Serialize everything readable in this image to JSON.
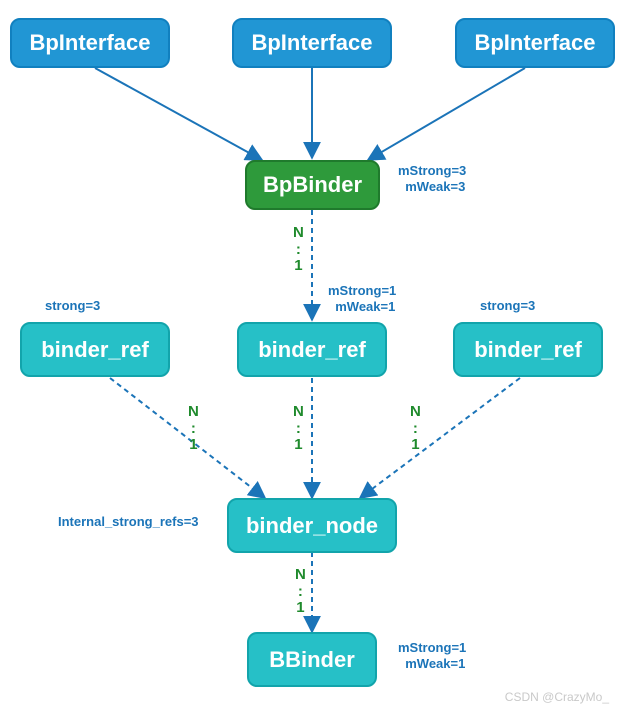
{
  "nodes": {
    "bp1": "BpInterface",
    "bp2": "BpInterface",
    "bp3": "BpInterface",
    "bpbinder": "BpBinder",
    "ref1": "binder_ref",
    "ref2": "binder_ref",
    "ref3": "binder_ref",
    "bnode": "binder_node",
    "bbinder": "BBinder"
  },
  "annotations": {
    "bpbinder_refs": "mStrong=3\n  mWeak=3",
    "ref1_strong": "strong=3",
    "ref2_refs": "mStrong=1\n  mWeak=1",
    "ref3_strong": "strong=3",
    "bnode_internal": "Internal_strong_refs=3",
    "bbinder_refs": "mStrong=1\n  mWeak=1"
  },
  "edge_labels": {
    "n1a": "N\n:\n1",
    "n1b": "N\n:\n1",
    "n1c": "N\n:\n1",
    "n1d": "N\n:\n1",
    "n1e": "N\n:\n1"
  },
  "watermark": "CSDN @CrazyMo_"
}
